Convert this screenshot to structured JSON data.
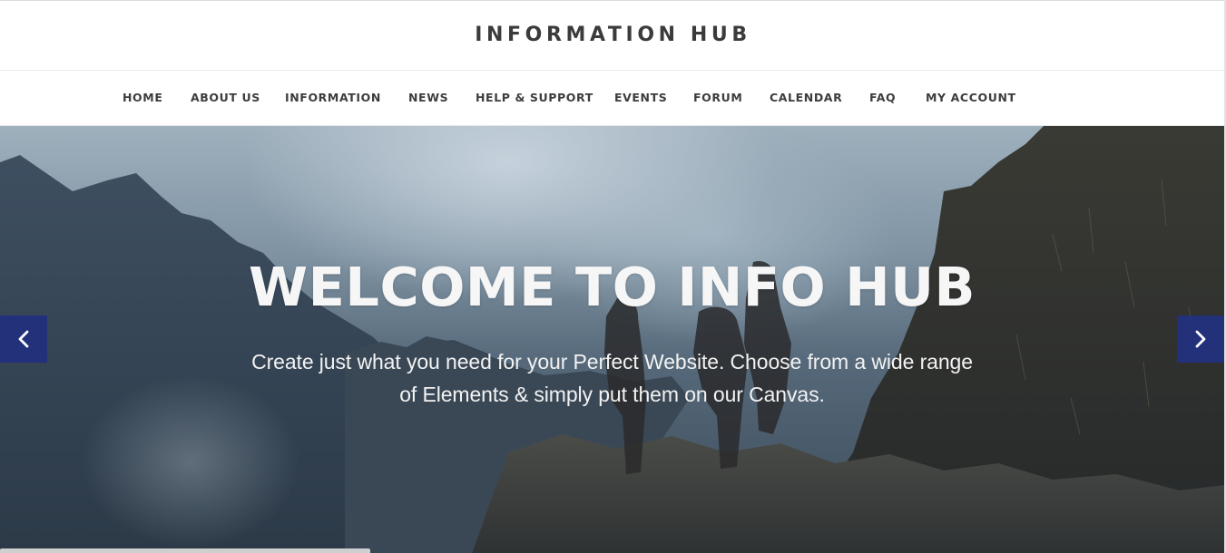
{
  "brand": {
    "title": "INFORMATION HUB"
  },
  "nav": {
    "items": [
      {
        "label": "HOME"
      },
      {
        "label": "ABOUT US"
      },
      {
        "label": "INFORMATION"
      },
      {
        "label": "NEWS"
      },
      {
        "label": "HELP & SUPPORT"
      },
      {
        "label": "EVENTS"
      },
      {
        "label": "FORUM"
      },
      {
        "label": "CALENDAR"
      },
      {
        "label": "FAQ"
      },
      {
        "label": "MY ACCOUNT"
      }
    ]
  },
  "hero": {
    "heading": "WELCOME TO INFO HUB",
    "copy_line_1": "Create just what you need for your Perfect Website. Choose from a wide range",
    "copy_line_2": "of Elements & simply put them on our Canvas.",
    "prev_icon": "chevron-left-icon",
    "next_icon": "chevron-right-icon"
  },
  "colors": {
    "arrow_background": "#23307a",
    "brand_text": "#3b3b3b",
    "nav_text": "#3d3d3d",
    "hero_text": "#f6f6f6"
  }
}
